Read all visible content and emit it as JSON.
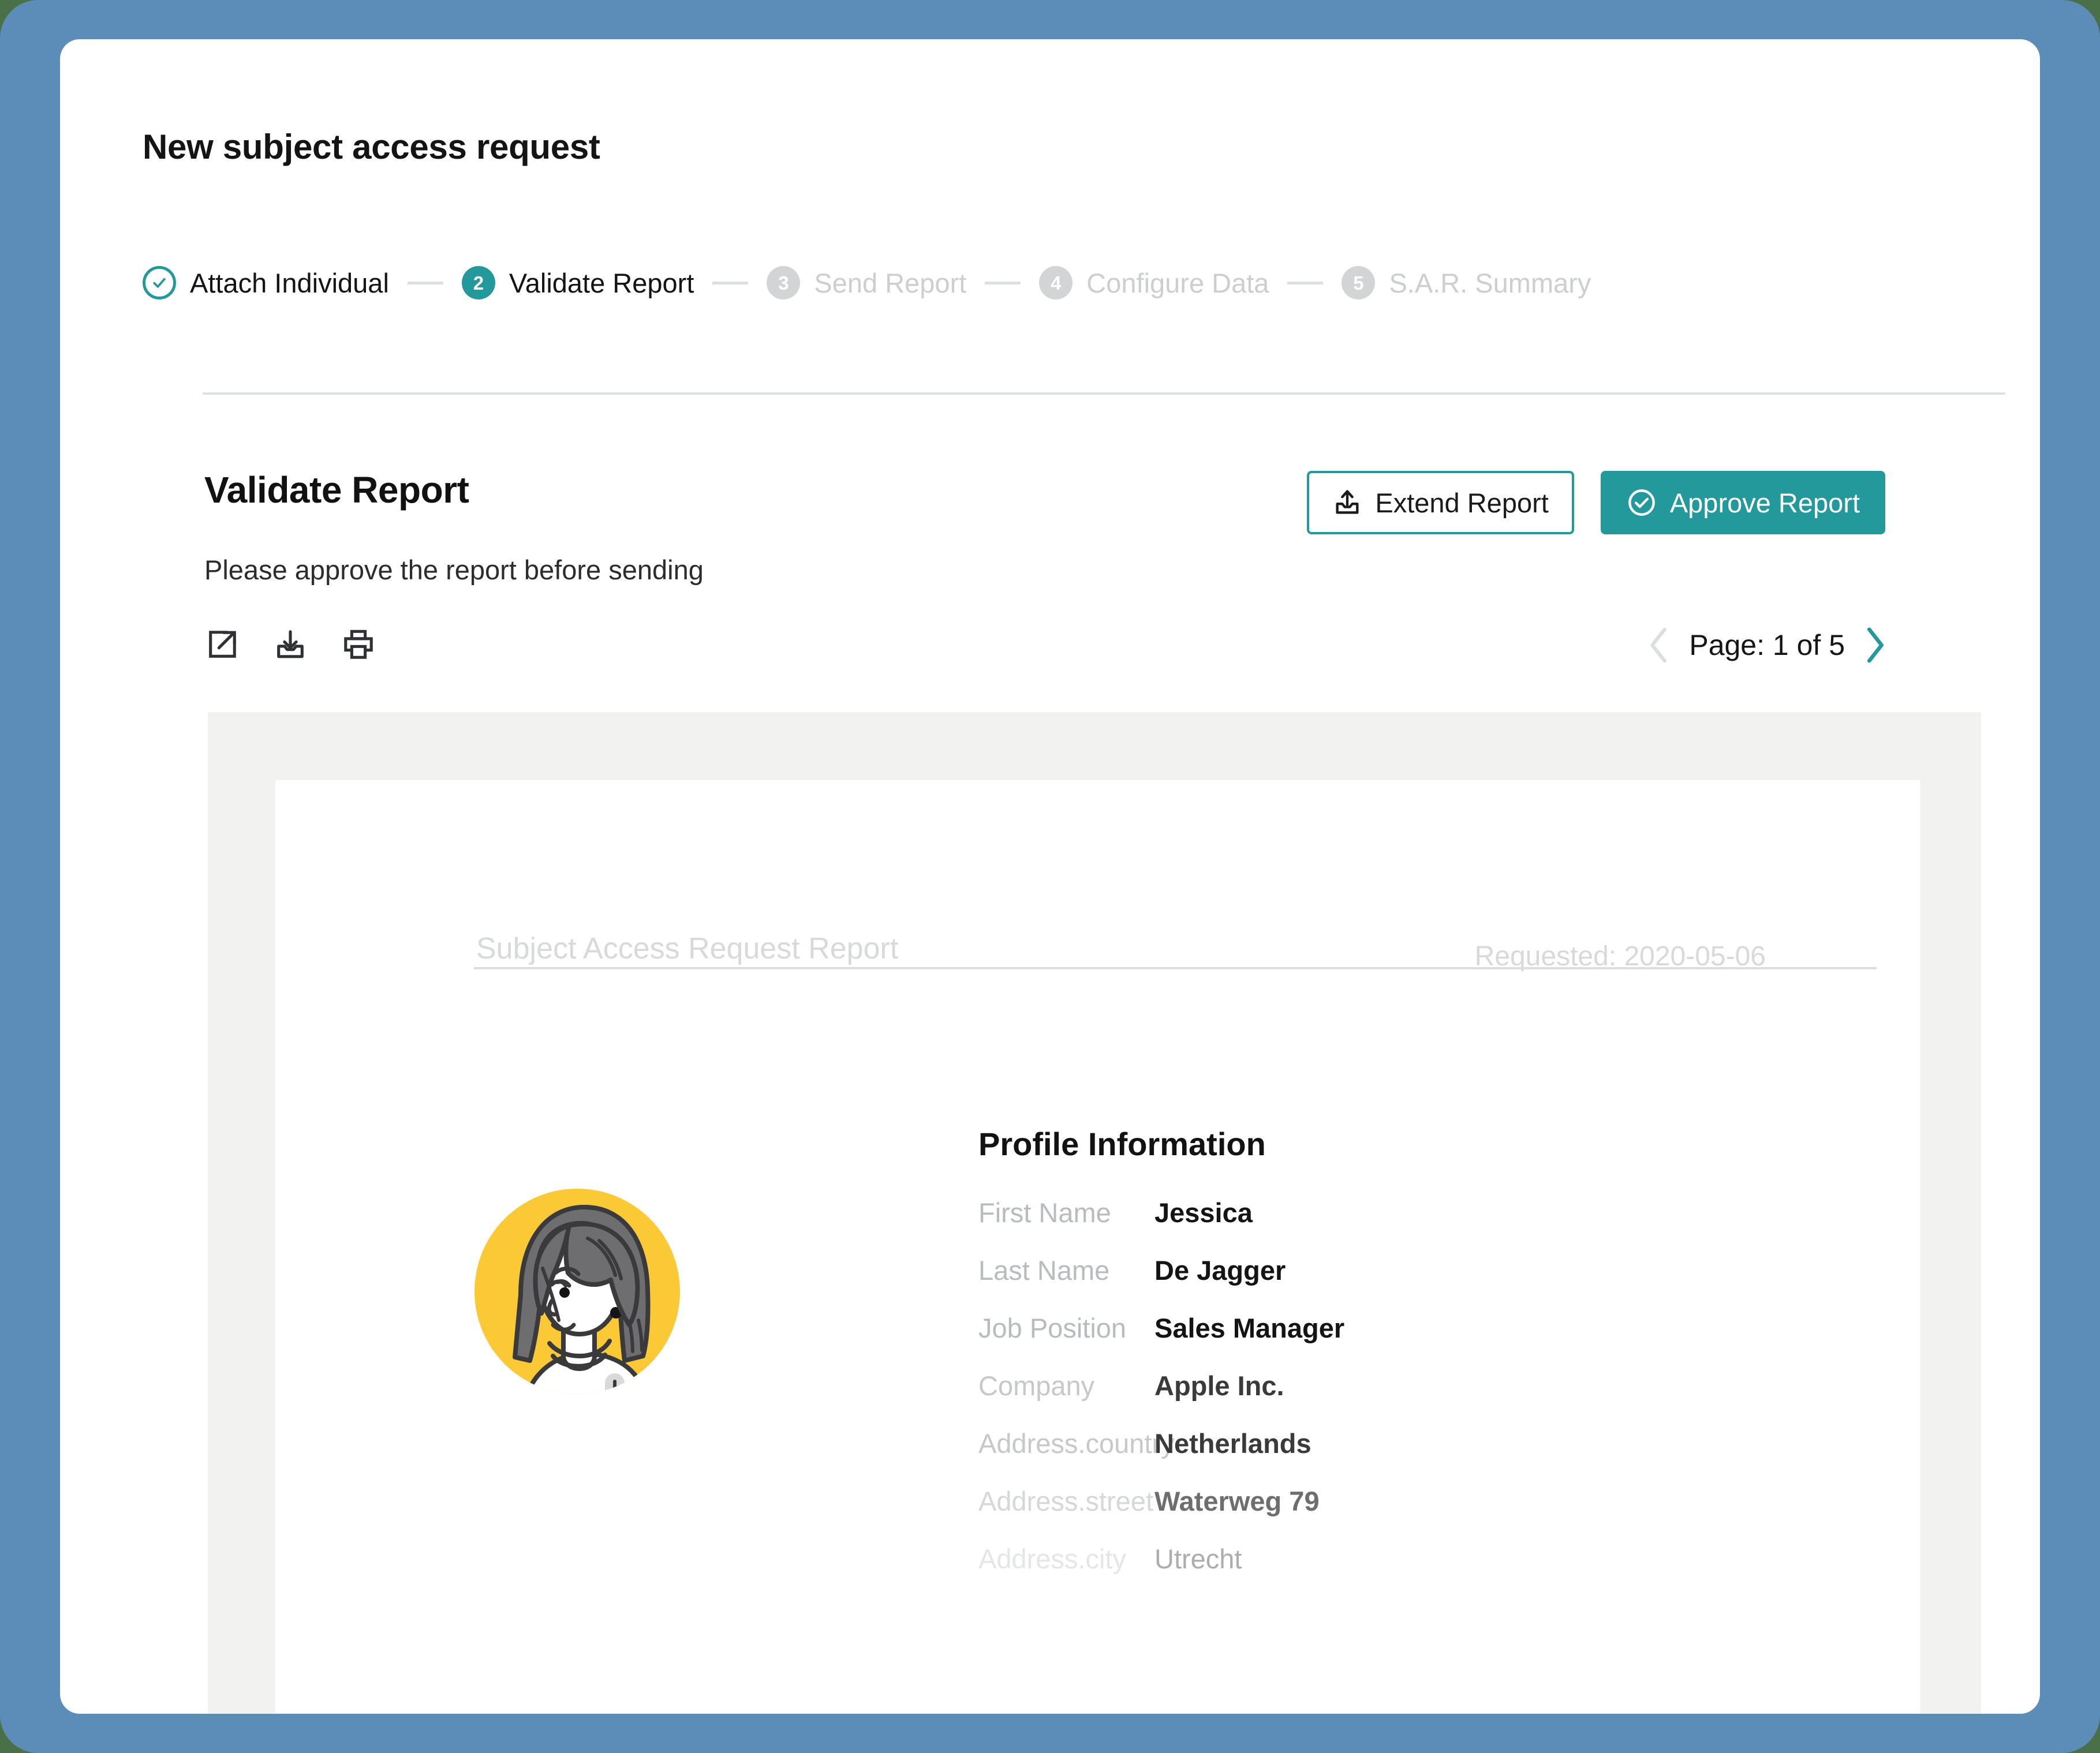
{
  "window": {
    "frame_color": "#5b8db8",
    "backdrop_color": "#4a7048",
    "card_color": "#ffffff"
  },
  "header": {
    "title": "New subject access request"
  },
  "stepper": {
    "steps": [
      {
        "marker": "check",
        "number": "1",
        "label": "Attach Individual",
        "state": "done"
      },
      {
        "marker": "number",
        "number": "2",
        "label": "Validate Report",
        "state": "active"
      },
      {
        "marker": "number",
        "number": "3",
        "label": "Send Report",
        "state": "future"
      },
      {
        "marker": "number",
        "number": "4",
        "label": "Configure Data",
        "state": "future"
      },
      {
        "marker": "number",
        "number": "5",
        "label": "S.A.R. Summary",
        "state": "future"
      }
    ],
    "accent_color": "#23999b",
    "inactive_color": "#d2d4d5"
  },
  "section": {
    "title": "Validate Report",
    "subtitle": "Please approve the report before sending"
  },
  "actions": {
    "extend_label": "Extend Report",
    "extend_icon": "upload-icon",
    "approve_label": "Approve Report",
    "approve_icon": "check-circle-icon",
    "primary_color": "#23999b"
  },
  "preview_toolbar": {
    "tools": [
      {
        "icon": "open-external-icon",
        "name": "open-in-new-window-button"
      },
      {
        "icon": "download-icon",
        "name": "download-button"
      },
      {
        "icon": "print-icon",
        "name": "print-button"
      }
    ]
  },
  "pagination": {
    "prev_icon": "chevron-left-icon",
    "next_icon": "chevron-right-icon",
    "label": "Page: 1 of 5",
    "current_page": 1,
    "total_pages": 5,
    "prev_disabled_color": "#dcdedf",
    "next_color": "#23999b"
  },
  "report": {
    "title": "Subject Access Request Report",
    "requested_label": "Requested: 2020-05-06",
    "avatar": {
      "name": "user-avatar-illustration",
      "background_color": "#fbc836",
      "hair_color": "#6e6d70",
      "outline_color": "#3a3a3c"
    },
    "profile": {
      "heading": "Profile Information",
      "rows": [
        {
          "key": "First Name",
          "value": "Jessica",
          "fade": ""
        },
        {
          "key": "Last Name",
          "value": "De Jagger",
          "fade": ""
        },
        {
          "key": "Job Position",
          "value": "Sales Manager",
          "fade": ""
        },
        {
          "key": "Company",
          "value": "Apple Inc.",
          "fade": "f1"
        },
        {
          "key": "Address.country",
          "value": "Netherlands",
          "fade": "f1"
        },
        {
          "key": "Address.street",
          "value": "Waterweg 79",
          "fade": "f2"
        },
        {
          "key": "Address.city",
          "value": "Utrecht",
          "fade": "f3"
        }
      ]
    }
  }
}
